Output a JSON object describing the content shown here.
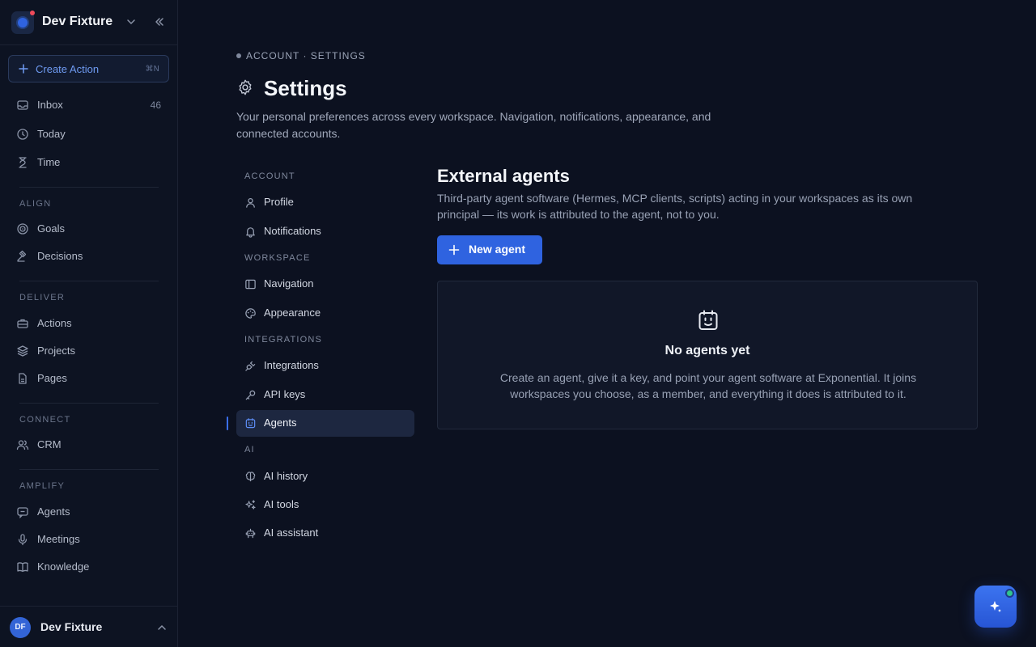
{
  "workspace": {
    "name": "Dev Fixture"
  },
  "sidebar": {
    "create": {
      "label": "Create Action",
      "shortcut": "⌘N"
    },
    "top_items": [
      {
        "label": "Inbox",
        "count": "46",
        "icon": "inbox-icon"
      },
      {
        "label": "Today",
        "icon": "clock-icon"
      },
      {
        "label": "Time",
        "icon": "hourglass-icon"
      }
    ],
    "sections": [
      {
        "label": "ALIGN",
        "items": [
          {
            "label": "Goals",
            "icon": "target-icon"
          },
          {
            "label": "Decisions",
            "icon": "gavel-icon"
          }
        ]
      },
      {
        "label": "DELIVER",
        "items": [
          {
            "label": "Actions",
            "icon": "briefcase-icon"
          },
          {
            "label": "Projects",
            "icon": "layers-icon"
          },
          {
            "label": "Pages",
            "icon": "file-icon"
          }
        ]
      },
      {
        "label": "CONNECT",
        "items": [
          {
            "label": "CRM",
            "icon": "users-icon"
          }
        ]
      },
      {
        "label": "AMPLIFY",
        "items": [
          {
            "label": "Agents",
            "icon": "chat-icon"
          },
          {
            "label": "Meetings",
            "icon": "mic-icon"
          },
          {
            "label": "Knowledge",
            "icon": "book-icon"
          }
        ]
      }
    ],
    "user": {
      "initials": "DF",
      "name": "Dev Fixture"
    }
  },
  "page": {
    "breadcrumb": "ACCOUNT · SETTINGS",
    "title": "Settings",
    "description": "Your personal preferences across every workspace. Navigation, notifications, appearance, and connected accounts."
  },
  "settings_nav": {
    "sections": [
      {
        "label": "ACCOUNT",
        "items": [
          {
            "label": "Profile",
            "icon": "user-icon"
          },
          {
            "label": "Notifications",
            "icon": "bell-icon"
          }
        ]
      },
      {
        "label": "WORKSPACE",
        "items": [
          {
            "label": "Navigation",
            "icon": "sidebar-icon"
          },
          {
            "label": "Appearance",
            "icon": "palette-icon"
          }
        ]
      },
      {
        "label": "INTEGRATIONS",
        "items": [
          {
            "label": "Integrations",
            "icon": "plug-icon"
          },
          {
            "label": "API keys",
            "icon": "key-icon"
          },
          {
            "label": "Agents",
            "icon": "bot-icon",
            "active": true
          }
        ]
      },
      {
        "label": "AI",
        "items": [
          {
            "label": "AI history",
            "icon": "brain-icon"
          },
          {
            "label": "AI tools",
            "icon": "sparkles-icon"
          },
          {
            "label": "AI assistant",
            "icon": "robot-icon"
          }
        ]
      }
    ]
  },
  "content": {
    "title": "External agents",
    "description": "Third-party agent software (Hermes, MCP clients, scripts) acting in your workspaces as its own principal — its work is attributed to the agent, not to you.",
    "new_button": "New agent",
    "empty": {
      "title": "No agents yet",
      "description": "Create an agent, give it a key, and point your agent software at Exponential. It joins workspaces you choose, as a member, and everything it does is attributed to it."
    }
  },
  "colors": {
    "accent": "#2f63e0",
    "background": "#0c1120",
    "sidebar": "#0d1322",
    "online": "#30c48d"
  }
}
